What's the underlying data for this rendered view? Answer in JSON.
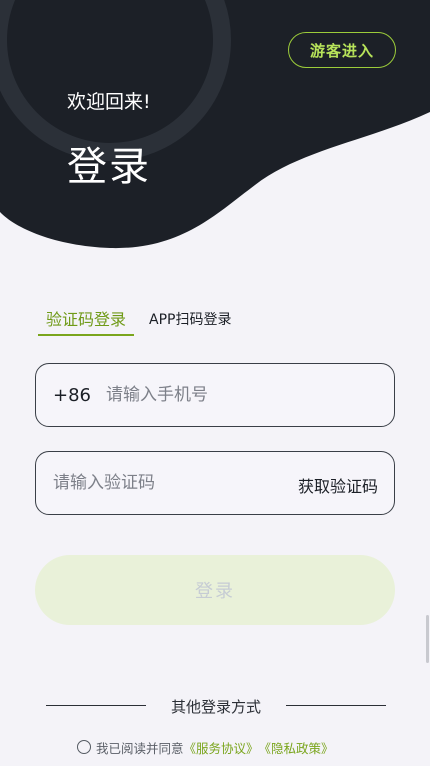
{
  "header": {
    "guest_label": "游客进入",
    "welcome": "欢迎回来!",
    "title": "登录"
  },
  "tabs": [
    {
      "label": "验证码登录",
      "active": true
    },
    {
      "label": "APP扫码登录",
      "active": false
    }
  ],
  "phone": {
    "prefix": "+86",
    "placeholder": "请输入手机号",
    "value": ""
  },
  "code": {
    "placeholder": "请输入验证码",
    "value": "",
    "get_code_label": "获取验证码"
  },
  "login_button": {
    "label": "登录",
    "enabled": false
  },
  "other_login": {
    "label": "其他登录方式"
  },
  "agreement": {
    "prefix": "我已阅读并同意",
    "service_link": "《服务协议》",
    "privacy_link": "《隐私政策》",
    "checked": false
  },
  "colors": {
    "hero_dark": "#1c2027",
    "accent_green": "#7aa51d",
    "guest_border": "#9ccc3a",
    "login_disabled_bg": "#e9f1d9",
    "page_bg": "#f4f3f8"
  },
  "icons": {
    "agreement_checkbox": "circle-outline-icon"
  }
}
